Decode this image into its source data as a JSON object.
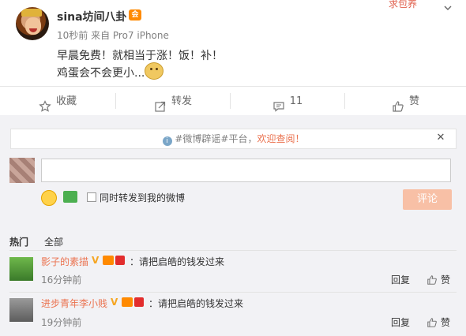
{
  "post": {
    "username": "sina坊间八卦",
    "vip_badge": "会",
    "meta": "10秒前 来自 Pro7 iPhone",
    "corner_text": "求包养",
    "line1": "早晨免费！就相当于涨！饭！补！",
    "line2": "鸡蛋会不会更小..."
  },
  "actions": {
    "favorite": "收藏",
    "repost": "转发",
    "comment_count": "11",
    "like": "赞"
  },
  "notice": {
    "hashtag": "#微博辟谣#平台，",
    "link": "欢迎查阅！"
  },
  "composer": {
    "input_value": "",
    "checkbox_label": "同时转发到我的微博",
    "submit": "评论"
  },
  "tabs": {
    "hot": "热门",
    "all": "全部"
  },
  "comments": [
    {
      "name": "影子的素描",
      "text": "：请把启皓的钱发过来",
      "time": "16分钟前",
      "reply": "回复",
      "like": "赞"
    },
    {
      "name": "进步青年李小贱",
      "text": "：请把启皓的钱发过来",
      "time": "19分钟前",
      "reply": "回复",
      "like": "赞"
    }
  ],
  "colors": {
    "accent": "#eb7350",
    "panel_bg": "#f2f2f5",
    "submit_disabled": "#f8c0a6"
  }
}
